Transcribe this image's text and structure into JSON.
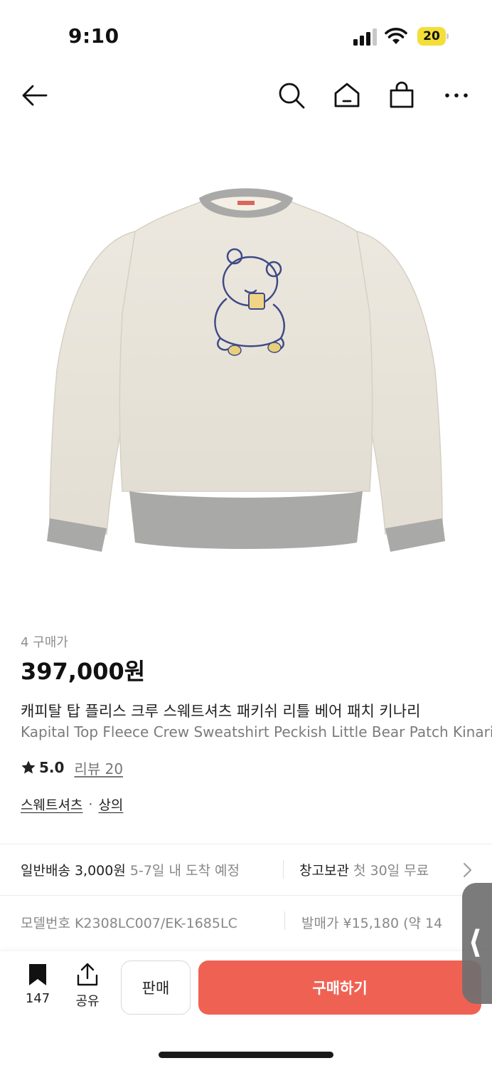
{
  "status_bar": {
    "time": "9:10",
    "battery": "20",
    "battery_color": "#f3de3a"
  },
  "nav": {
    "back_icon": "arrow-left-icon",
    "search_icon": "search-icon",
    "home_icon": "home-icon",
    "cart_icon": "shopping-bag-icon",
    "more_icon": "more-horizontal-icon"
  },
  "product": {
    "purchase_count": "4 구매가",
    "price": "397,000원",
    "title_ko": "캐피탈 탑 플리스 크루 스웨트셔츠 패키쉬 리틀 베어 패치 키나리",
    "title_en": "Kapital Top Fleece Crew Sweatshirt Peckish Little Bear Patch Kinari",
    "rating": "5.0",
    "review_text": "리뷰 20",
    "categories": [
      "스웨트셔츠",
      "상의"
    ],
    "category_separator": "·"
  },
  "shipping": {
    "label": "일반배송",
    "fee": "3,000원",
    "eta": "5-7일 내 도착 예정",
    "storage_label": "창고보관",
    "storage_note": "첫 30일 무료"
  },
  "details": {
    "model_label": "모델번호",
    "model_value": "K2308LC007/EK-1685LC",
    "release_label": "발매가",
    "release_value": "¥15,180 (약 14"
  },
  "bottom_bar": {
    "bookmark_count": "147",
    "share_label": "공유",
    "sell_label": "판매",
    "buy_label": "구매하기",
    "buy_color": "#ef6253"
  },
  "side_handle": {
    "glyph": "⟨"
  }
}
